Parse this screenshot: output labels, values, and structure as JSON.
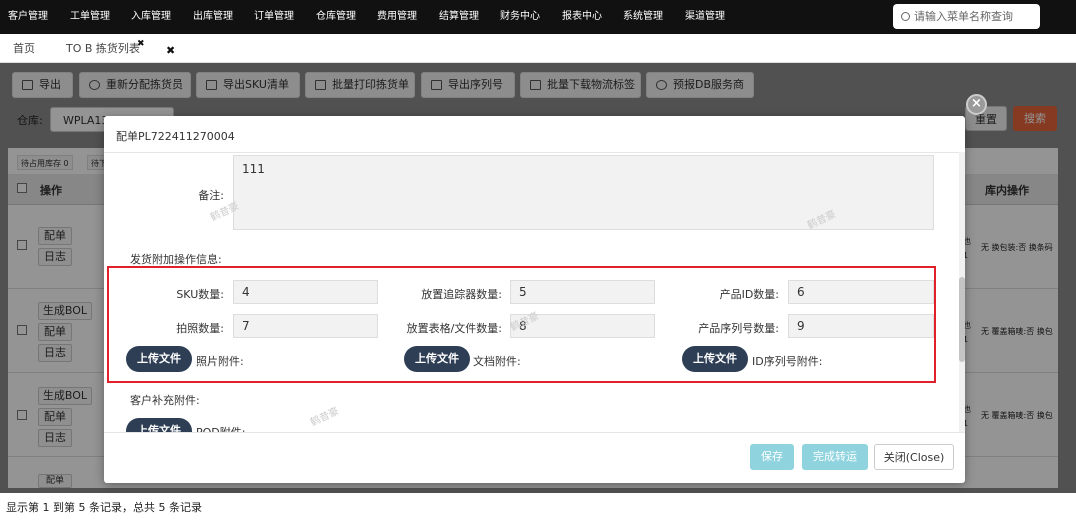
{
  "nav": {
    "items": [
      "客户管理",
      "工单管理",
      "入库管理",
      "出库管理",
      "订单管理",
      "仓库管理",
      "费用管理",
      "结算管理",
      "财务中心",
      "报表中心",
      "系统管理",
      "渠道管理"
    ],
    "search_placeholder": "请输入菜单名称查询"
  },
  "tabs": {
    "home": "首页",
    "current": "TO B 拣货列表",
    "close_glyph": "✖"
  },
  "toolbar": {
    "buttons": [
      "导出",
      "重新分配拣货员",
      "导出SKU清单",
      "批量打印拣货单",
      "导出序列号",
      "批量下载物流标签",
      "预报DB服务商"
    ]
  },
  "filters": {
    "warehouse_label": "仓库:",
    "warehouse_value": "WPLA13",
    "reset": "重置",
    "search": "搜索"
  },
  "grid": {
    "chips": [
      "待占用库存 0",
      "待下"
    ],
    "header_op": "操作",
    "header_inv": "库内操作",
    "rows": [
      {
        "actions": [
          "配单",
          "日志"
        ],
        "side_a": "也",
        "side_b": "1",
        "inv": "无 换包装:否 换条码"
      },
      {
        "actions": [
          "生成BOL",
          "配单",
          "日志"
        ],
        "side_a": "也",
        "side_b": "1",
        "inv": "无 覆盖箱唛:否 换包"
      },
      {
        "actions": [
          "生成BOL",
          "配单",
          "日志"
        ],
        "side_a": "也",
        "side_b": "1",
        "inv": "无 覆盖箱唛:否 换包"
      }
    ],
    "extra_row_action": "配单",
    "footer": "显示第 1 到第 5 条记录，总共 5 条记录"
  },
  "modal": {
    "title": "配单PL722411270004",
    "remark_label": "备注:",
    "remark_value": "111",
    "section_ship": "发货附加操作信息:",
    "fields": [
      {
        "label": "SKU数量:",
        "value": "4"
      },
      {
        "label": "放置追踪器数量:",
        "value": "5"
      },
      {
        "label": "产品ID数量:",
        "value": "6"
      },
      {
        "label": "拍照数量:",
        "value": "7"
      },
      {
        "label": "放置表格/文件数量:",
        "value": "8"
      },
      {
        "label": "产品序列号数量:",
        "value": "9"
      }
    ],
    "upload_label": "上传文件",
    "attach": [
      "照片附件:",
      "文档附件:",
      "ID序列号附件:"
    ],
    "section_customer": "客户补充附件:",
    "pod_label": "POD附件:",
    "footer": {
      "save": "保存",
      "complete": "完成转运",
      "close": "关闭(Close)"
    },
    "close_glyph": "×"
  },
  "watermark": "鹤昔豪",
  "colors": {
    "nav_bg": "#111111",
    "search_btn": "#e8643c",
    "upload_btn": "#2e3e55",
    "highlight": "#e0202a",
    "primary_disabled": "#8fd3df"
  },
  "icons": [
    "search-icon",
    "export-icon",
    "user-icon",
    "print-icon",
    "download-icon",
    "close-icon",
    "checkbox-icon"
  ]
}
